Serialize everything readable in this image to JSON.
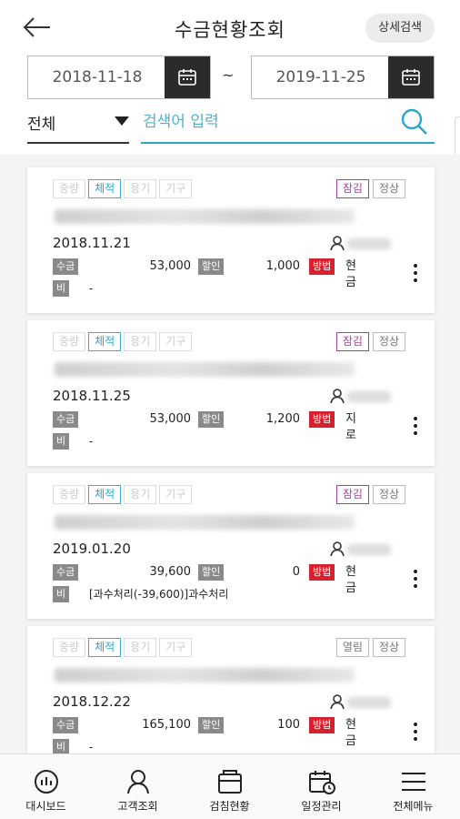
{
  "header": {
    "back_icon": "arrow-left-icon",
    "title": "수금현황조회",
    "detail_search_label": "상세검색"
  },
  "date_range": {
    "from": "2018-11-18",
    "separator": "~",
    "to": "2019-11-25",
    "calendar_icon": "calendar-icon"
  },
  "filter": {
    "selected": "전체",
    "search_placeholder": "검색어 입력",
    "search_icon": "search-icon"
  },
  "cards": [
    {
      "tags": [
        "중량",
        "체적",
        "용기",
        "기구"
      ],
      "active_tag": "체적",
      "status": [
        "잠김",
        "정상"
      ],
      "status_lock": true,
      "date": "2018.11.21",
      "collect_label": "수금",
      "collect_amount": "53,000",
      "discount_label": "할인",
      "discount_amount": "1,000",
      "method_label": "방법",
      "method": "현금",
      "note_label": "비고",
      "note": "-"
    },
    {
      "tags": [
        "중량",
        "체적",
        "용기",
        "기구"
      ],
      "active_tag": "체적",
      "status": [
        "잠김",
        "정상"
      ],
      "status_lock": true,
      "date": "2018.11.25",
      "collect_label": "수금",
      "collect_amount": "53,000",
      "discount_label": "할인",
      "discount_amount": "1,200",
      "method_label": "방법",
      "method": "지로",
      "note_label": "비고",
      "note": "-"
    },
    {
      "tags": [
        "중량",
        "체적",
        "용기",
        "기구"
      ],
      "active_tag": "체적",
      "status": [
        "잠김",
        "정상"
      ],
      "status_lock": true,
      "date": "2019.01.20",
      "collect_label": "수금",
      "collect_amount": "39,600",
      "discount_label": "할인",
      "discount_amount": "0",
      "method_label": "방법",
      "method": "현금",
      "note_label": "비고",
      "note": "[과수처리(-39,600)]과수처리"
    },
    {
      "tags": [
        "중량",
        "체적",
        "용기",
        "기구"
      ],
      "active_tag": "체적",
      "status": [
        "열림",
        "정상"
      ],
      "status_lock": false,
      "date": "2018.12.22",
      "collect_label": "수금",
      "collect_amount": "165,100",
      "discount_label": "할인",
      "discount_amount": "100",
      "method_label": "방법",
      "method": "현금",
      "note_label": "비고",
      "note": "-"
    }
  ],
  "tabbar": [
    {
      "label": "대시보드",
      "icon": "dashboard-icon"
    },
    {
      "label": "고객조회",
      "icon": "customer-icon"
    },
    {
      "label": "검침현황",
      "icon": "meter-icon"
    },
    {
      "label": "일정관리",
      "icon": "schedule-icon"
    },
    {
      "label": "전체메뉴",
      "icon": "menu-icon"
    }
  ],
  "colors": {
    "accent": "#2aa7c9",
    "lock": "#a0449b",
    "method_red": "#d8202e",
    "dark": "#2b2b2b"
  }
}
